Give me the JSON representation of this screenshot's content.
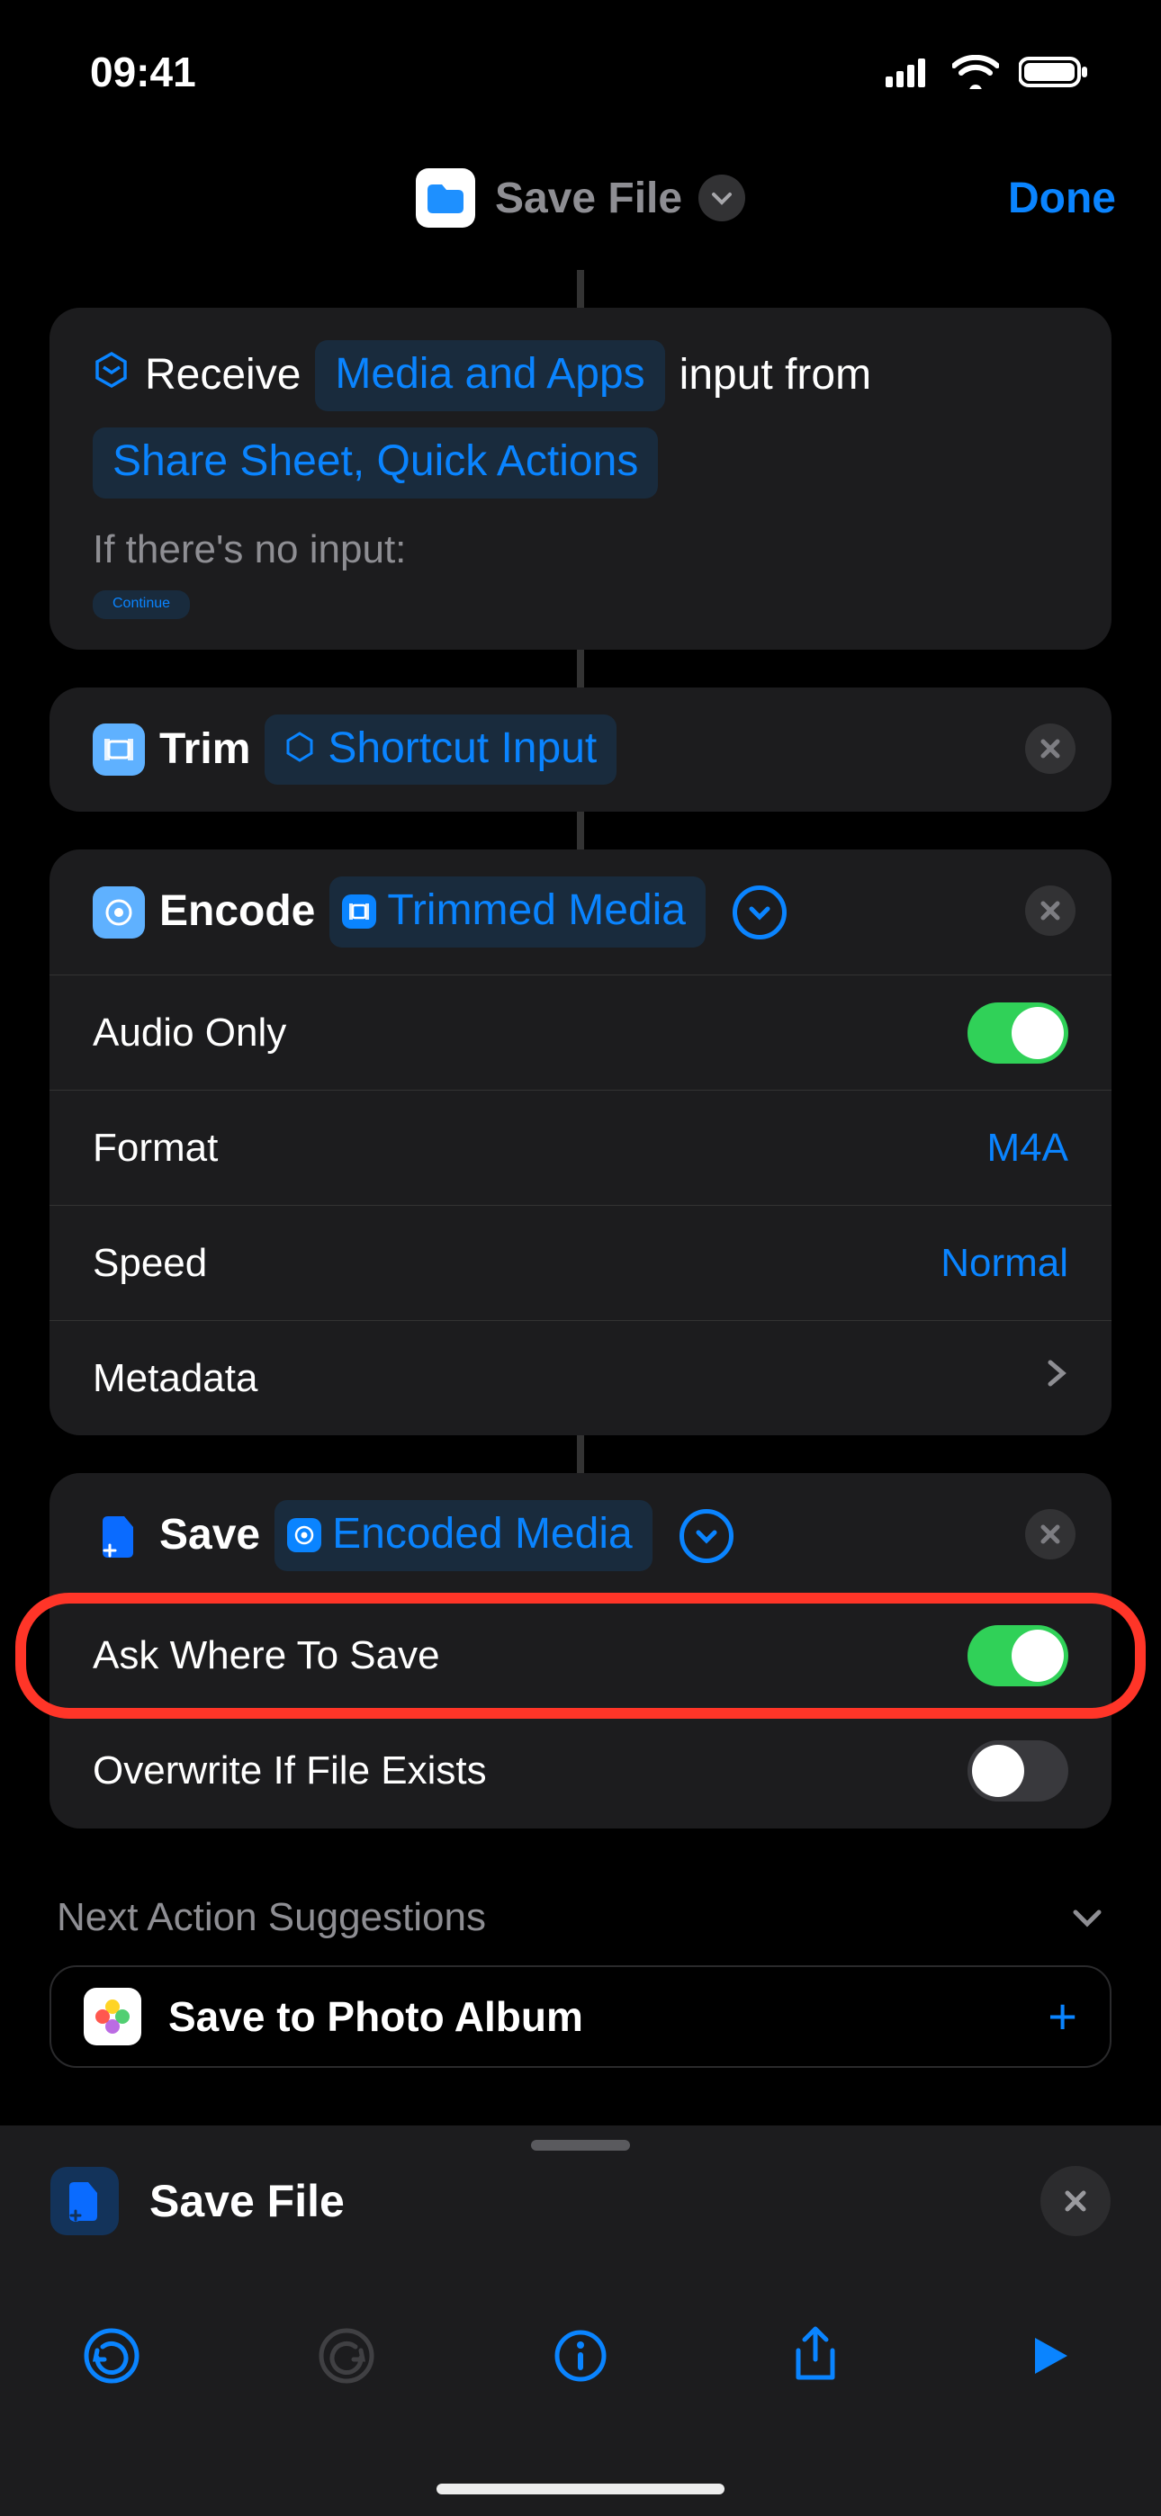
{
  "status": {
    "time": "09:41"
  },
  "header": {
    "title": "Save File",
    "done": "Done"
  },
  "actions": [
    {
      "name": "receive",
      "words": {
        "receive": "Receive",
        "input_token": "Media and Apps",
        "from": "input from",
        "sources_token": "Share Sheet, Quick Actions",
        "noinput": "If there's no input:",
        "continue": "Continue"
      }
    },
    {
      "name": "trim",
      "verb": "Trim",
      "var": "Shortcut Input"
    },
    {
      "name": "encode",
      "verb": "Encode",
      "var": "Trimmed Media",
      "rows": [
        {
          "label": "Audio Only",
          "type": "switch",
          "value": true
        },
        {
          "label": "Format",
          "type": "value",
          "value": "M4A"
        },
        {
          "label": "Speed",
          "type": "value",
          "value": "Normal"
        },
        {
          "label": "Metadata",
          "type": "disclosure"
        }
      ]
    },
    {
      "name": "save",
      "verb": "Save",
      "var": "Encoded Media",
      "rows": [
        {
          "label": "Ask Where To Save",
          "type": "switch",
          "value": true,
          "highlight": true
        },
        {
          "label": "Overwrite If File Exists",
          "type": "switch",
          "value": false
        }
      ]
    }
  ],
  "suggestions": {
    "header": "Next Action Suggestions",
    "items": [
      {
        "label": "Save to Photo Album"
      }
    ]
  },
  "picker": {
    "label": "Save File"
  }
}
